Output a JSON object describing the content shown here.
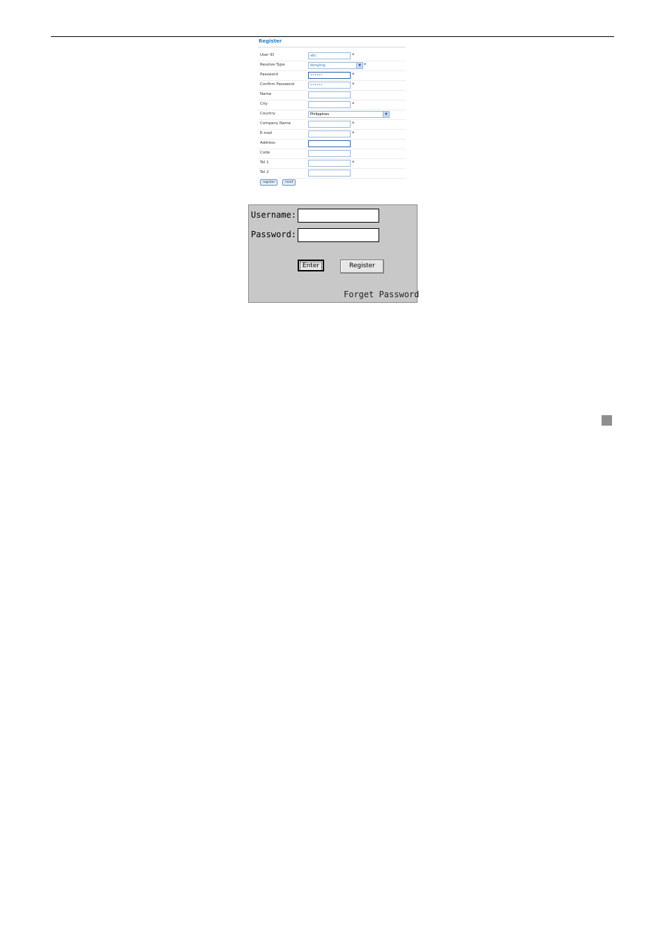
{
  "register": {
    "title": "Register",
    "fields": [
      {
        "label": "User ID",
        "value": "abc",
        "required": "*"
      },
      {
        "label": "Resolve Type",
        "value": "dongling",
        "required": "*"
      },
      {
        "label": "Password",
        "value": "••••••",
        "required": "*"
      },
      {
        "label": "Confirm Password",
        "value": "••••••",
        "required": "*"
      },
      {
        "label": "Name",
        "value": "",
        "required": ""
      },
      {
        "label": "City",
        "value": "",
        "required": "*"
      },
      {
        "label": "Country",
        "value": "Philippines",
        "required": ""
      },
      {
        "label": "Company Name",
        "value": "",
        "required": "*"
      },
      {
        "label": "E-mail",
        "value": "",
        "required": "*"
      },
      {
        "label": "Address",
        "value": "",
        "required": ""
      },
      {
        "label": "Code",
        "value": "",
        "required": ""
      },
      {
        "label": "Tel 1",
        "value": "",
        "required": "*"
      },
      {
        "label": "Tel 2",
        "value": "",
        "required": ""
      }
    ],
    "register_button": "register",
    "reset_button": "reset"
  },
  "login": {
    "username_label": "Username:",
    "password_label": "Password:",
    "enter_button": "Enter",
    "register_button": "Register",
    "forget_link": "Forget Password"
  },
  "icons": {
    "dropdown": "chevron-down-icon"
  },
  "colors": {
    "accent": "#2a7fc1",
    "panel_bg": "#c8c8c8",
    "marker": "#8f8f8f"
  }
}
